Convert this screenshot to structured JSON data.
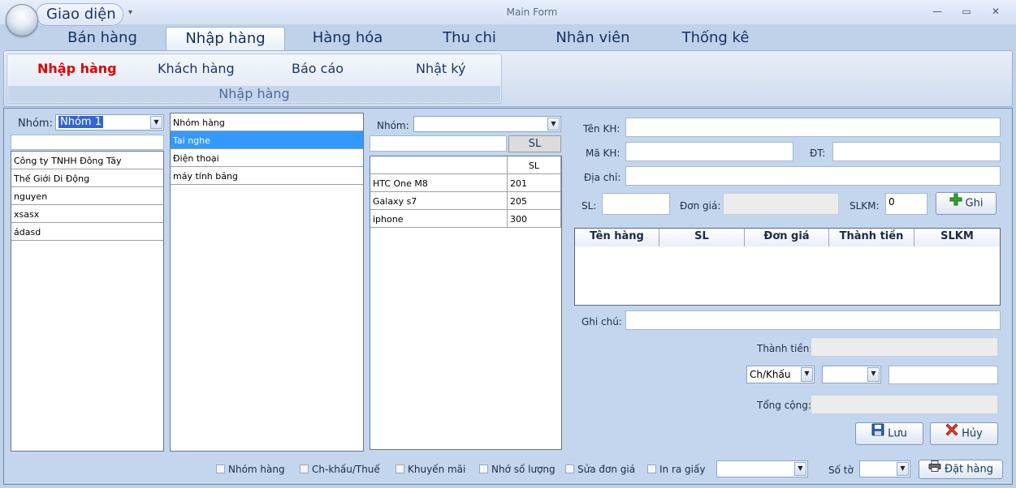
{
  "app": {
    "quick_access_label": "Giao diện",
    "window_title": "Main Form"
  },
  "ribbon": {
    "tabs": [
      "Bán hàng",
      "Nhập hàng",
      "Hàng hóa",
      "Thu chi",
      "Nhân viên",
      "Thống kê"
    ],
    "active_tab": "Nhập hàng",
    "buttons": [
      "Nhập hàng",
      "Khách hàng",
      "Báo cáo",
      "Nhật ký"
    ],
    "active_button": "Nhập hàng",
    "group_caption": "Nhập hàng"
  },
  "left_panel": {
    "group_label": "Nhóm:",
    "group_value": "Nhóm 1",
    "search_value": "",
    "customers": [
      "Công ty TNHH Đông Tây",
      "Thế Giới Di Động",
      "nguyen",
      "xsasx",
      "ádasd"
    ]
  },
  "category_panel": {
    "header": "Nhóm hàng",
    "items": [
      "Tai nghe",
      "Điện thoại",
      "máy tính bảng"
    ],
    "selected_index": 0
  },
  "product_panel": {
    "group_label": "Nhóm:",
    "group_value": "",
    "search_value": "",
    "sl_button": "SL",
    "columns": [
      "",
      "SL"
    ],
    "rows": [
      {
        "name": "HTC One M8",
        "sl": "201"
      },
      {
        "name": "Galaxy s7",
        "sl": "205"
      },
      {
        "name": "iphone",
        "sl": "300"
      }
    ]
  },
  "form": {
    "ten_kh_label": "Tên KH:",
    "ma_kh_label": "Mã KH:",
    "dt_label": "ĐT:",
    "dia_chi_label": "Địa chỉ:",
    "sl_label": "SL:",
    "don_gia_label": "Đơn giá:",
    "slkm_label": "SLKM:",
    "slkm_value": "0",
    "ghi_button": "Ghi",
    "table_headers": [
      "Tên hàng",
      "SL",
      "Đơn giá",
      "Thành tiền",
      "SLKM"
    ],
    "ghi_chu_label": "Ghi chú:",
    "thanh_tien_label": "Thành tiền:",
    "chkhau_value": "Ch/Khấu",
    "tong_cong_label": "Tổng cộng:",
    "luu_button": "Lưu",
    "huy_button": "Hủy"
  },
  "bottom_bar": {
    "checkboxes": [
      "Nhóm hàng",
      "Ch-khấu/Thuế",
      "Khuyến mãi",
      "Nhớ số lượng",
      "Sửa đơn giá",
      "In ra giấy"
    ],
    "so_to_label": "Số tờ",
    "dat_hang_button": "Đặt hàng"
  },
  "colors": {
    "active_ribbon_button": "#e00000",
    "selected_row": "#3399ff",
    "panel_bg": "#c3d6ee"
  }
}
